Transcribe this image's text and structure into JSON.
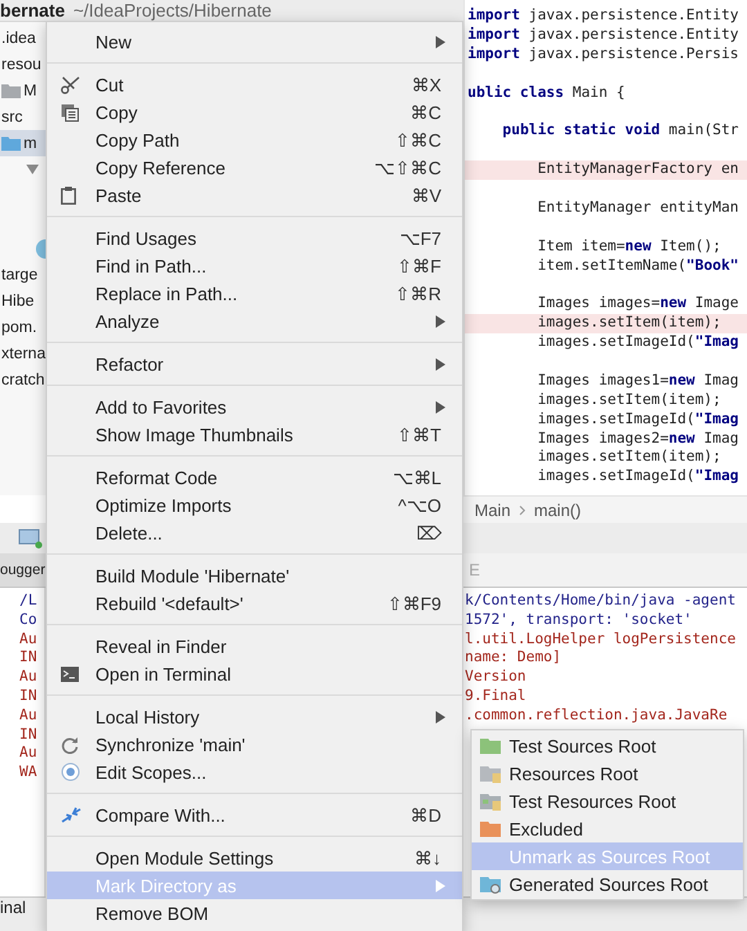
{
  "title": {
    "project": "bernate",
    "path": "~/IdeaProjects/Hibernate"
  },
  "project_tree": [
    {
      "label": ".idea",
      "selected": false
    },
    {
      "label": "resou",
      "selected": false
    },
    {
      "label": "M",
      "selected": false
    },
    {
      "label": "src",
      "selected": false
    },
    {
      "label": "m",
      "selected": true
    },
    {
      "selected": false
    },
    {
      "selected": false
    },
    {
      "label": "targe",
      "selected": false
    },
    {
      "label": "Hibe",
      "selected": false
    },
    {
      "label": "pom.",
      "selected": false
    },
    {
      "label": "xterna",
      "selected": false
    },
    {
      "label": "cratch",
      "selected": false
    }
  ],
  "editor": {
    "lines": [
      {
        "text": "**import** javax.persistence.Entity",
        "error": false
      },
      {
        "text": "**import** javax.persistence.Entity",
        "error": false
      },
      {
        "text": "**import** javax.persistence.Persis",
        "error": false
      },
      {
        "error": false
      },
      {
        "text": "**ublic class** Main {",
        "error": false
      },
      {
        "error": false
      },
      {
        "text": "    **public static void** main(Str",
        "error": false
      },
      {
        "error": false
      },
      {
        "text": "        EntityManagerFactory en",
        "error": true
      },
      {
        "error": false
      },
      {
        "text": "        EntityManager entityMan",
        "error": false
      },
      {
        "error": false
      },
      {
        "text": "        Item item=**new** Item();",
        "error": false
      },
      {
        "text": "        item.setItemName(**\"Book\"**",
        "error": false
      },
      {
        "error": false
      },
      {
        "text": "        Images images=**new** Image",
        "error": false
      },
      {
        "text": "        images.setItem(item);",
        "error": true
      },
      {
        "text": "        images.setImageId(**\"Imag**",
        "error": false
      },
      {
        "error": false
      },
      {
        "text": "        Images images1=**new** Imag",
        "error": false
      },
      {
        "text": "        images.setItem(item);",
        "error": false
      },
      {
        "text": "        images.setImageId(**\"Imag**",
        "error": false
      },
      {
        "text": "        Images images2=**new** Imag",
        "error": false
      },
      {
        "text": "        images.setItem(item);",
        "error": false
      },
      {
        "text": "        images.setImageId(**\"Imag**",
        "error": false
      }
    ]
  },
  "breadcrumb": [
    "Main",
    "main()"
  ],
  "debugger_tab": "ougger",
  "console_tab": "E",
  "console_left": [
    {
      "text": "/L",
      "color": "#23238a"
    },
    {
      "text": "Co",
      "color": "#23238a"
    },
    {
      "text": "Au",
      "color": "#a3261c"
    },
    {
      "text": "IN",
      "color": "#a3261c"
    },
    {
      "text": "Au",
      "color": "#a3261c"
    },
    {
      "text": "IN",
      "color": "#a3261c"
    },
    {
      "text": "Au",
      "color": "#a3261c"
    },
    {
      "text": "IN",
      "color": "#a3261c"
    },
    {
      "text": "Au",
      "color": "#a3261c"
    },
    {
      "text": "WA",
      "color": "#a3261c"
    }
  ],
  "console_right": [
    {
      "text": "k/Contents/Home/bin/java -agent",
      "color": "#23238a"
    },
    {
      "text": "1572', transport: 'socket'",
      "color": "#23238a"
    },
    {
      "text": "l.util.LogHelper logPersistence",
      "color": "#a3261c"
    },
    {
      "text": "name: Demo]",
      "color": "#a3261c"
    },
    {
      "text": "Version",
      "color": "#a3261c"
    },
    {
      "text": "9.Final",
      "color": "#a3261c"
    },
    {
      "text": ".common.reflection.java.JavaRe",
      "color": "#a3261c"
    }
  ],
  "status_tab": "inal",
  "context_menu": {
    "groups": [
      [
        {
          "label": "New",
          "submenu": true,
          "selected": false
        }
      ],
      [
        {
          "label": "Cut",
          "shortcut": "⌘X",
          "submenu": false,
          "selected": false
        },
        {
          "label": "Copy",
          "shortcut": "⌘C",
          "submenu": false,
          "selected": false
        },
        {
          "label": "Copy Path",
          "shortcut": "⇧⌘C",
          "submenu": false,
          "selected": false
        },
        {
          "label": "Copy Reference",
          "shortcut": "⌥⇧⌘C",
          "submenu": false,
          "selected": false
        },
        {
          "label": "Paste",
          "shortcut": "⌘V",
          "submenu": false,
          "selected": false
        }
      ],
      [
        {
          "label": "Find Usages",
          "shortcut": "⌥F7",
          "submenu": false,
          "selected": false
        },
        {
          "label": "Find in Path...",
          "shortcut": "⇧⌘F",
          "submenu": false,
          "selected": false
        },
        {
          "label": "Replace in Path...",
          "shortcut": "⇧⌘R",
          "submenu": false,
          "selected": false
        },
        {
          "label": "Analyze",
          "submenu": true,
          "selected": false
        }
      ],
      [
        {
          "label": "Refactor",
          "submenu": true,
          "selected": false
        }
      ],
      [
        {
          "label": "Add to Favorites",
          "submenu": true,
          "selected": false
        },
        {
          "label": "Show Image Thumbnails",
          "shortcut": "⇧⌘T",
          "submenu": false,
          "selected": false
        }
      ],
      [
        {
          "label": "Reformat Code",
          "shortcut": "⌥⌘L",
          "submenu": false,
          "selected": false
        },
        {
          "label": "Optimize Imports",
          "shortcut": "^⌥O",
          "submenu": false,
          "selected": false
        },
        {
          "label": "Delete...",
          "shortcut": "⌦",
          "submenu": false,
          "selected": false
        }
      ],
      [
        {
          "label": "Build Module 'Hibernate'",
          "submenu": false,
          "selected": false
        },
        {
          "label": "Rebuild '<default>'",
          "shortcut": "⇧⌘F9",
          "submenu": false,
          "selected": false
        }
      ],
      [
        {
          "label": "Reveal in Finder",
          "submenu": false,
          "selected": false
        },
        {
          "label": "Open in Terminal",
          "submenu": false,
          "selected": false
        }
      ],
      [
        {
          "label": "Local History",
          "submenu": true,
          "selected": false
        },
        {
          "label": "Synchronize 'main'",
          "submenu": false,
          "selected": false
        },
        {
          "label": "Edit Scopes...",
          "submenu": false,
          "selected": false
        }
      ],
      [
        {
          "label": "Compare With...",
          "shortcut": "⌘D",
          "submenu": false,
          "selected": false
        }
      ],
      [
        {
          "label": "Open Module Settings",
          "shortcut": "⌘↓",
          "submenu": false,
          "selected": false
        },
        {
          "label": "Mark Directory as",
          "submenu": true,
          "selected": true
        },
        {
          "label": "Remove BOM",
          "submenu": false,
          "selected": false
        }
      ]
    ]
  },
  "submenu": [
    {
      "label": "Test Sources Root",
      "selected": false
    },
    {
      "label": "Resources Root",
      "selected": false
    },
    {
      "label": "Test Resources Root",
      "selected": false
    },
    {
      "label": "Excluded",
      "selected": false
    },
    {
      "label": "Unmark as Sources Root",
      "selected": true
    },
    {
      "label": "Generated Sources Root",
      "selected": false
    }
  ]
}
